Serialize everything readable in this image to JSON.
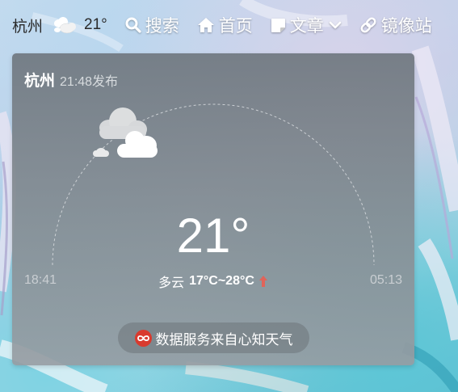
{
  "nav": {
    "city": "杭州",
    "temp": "21°",
    "weather_icon": "cloud-icon",
    "items": [
      {
        "label": "搜索",
        "icon": "search-icon"
      },
      {
        "label": "首页",
        "icon": "home-icon"
      },
      {
        "label": "文章",
        "icon": "note-icon"
      },
      {
        "label": "镜像站",
        "icon": "link-icon"
      }
    ]
  },
  "card": {
    "city": "杭州",
    "published": "21:48发布",
    "temperature": "21°",
    "condition": "多云",
    "range": "17°C~28°C",
    "sunrise": "18:41",
    "sunset": "05:13",
    "credit": "数据服务来自心知天气",
    "weather_icon": "cloudy-icon",
    "trend_icon": "arrow-up-icon"
  },
  "colors": {
    "card_bg": "#7c848b",
    "trend_arrow": "#e0645a",
    "credit_logo": "#d93a2e"
  }
}
